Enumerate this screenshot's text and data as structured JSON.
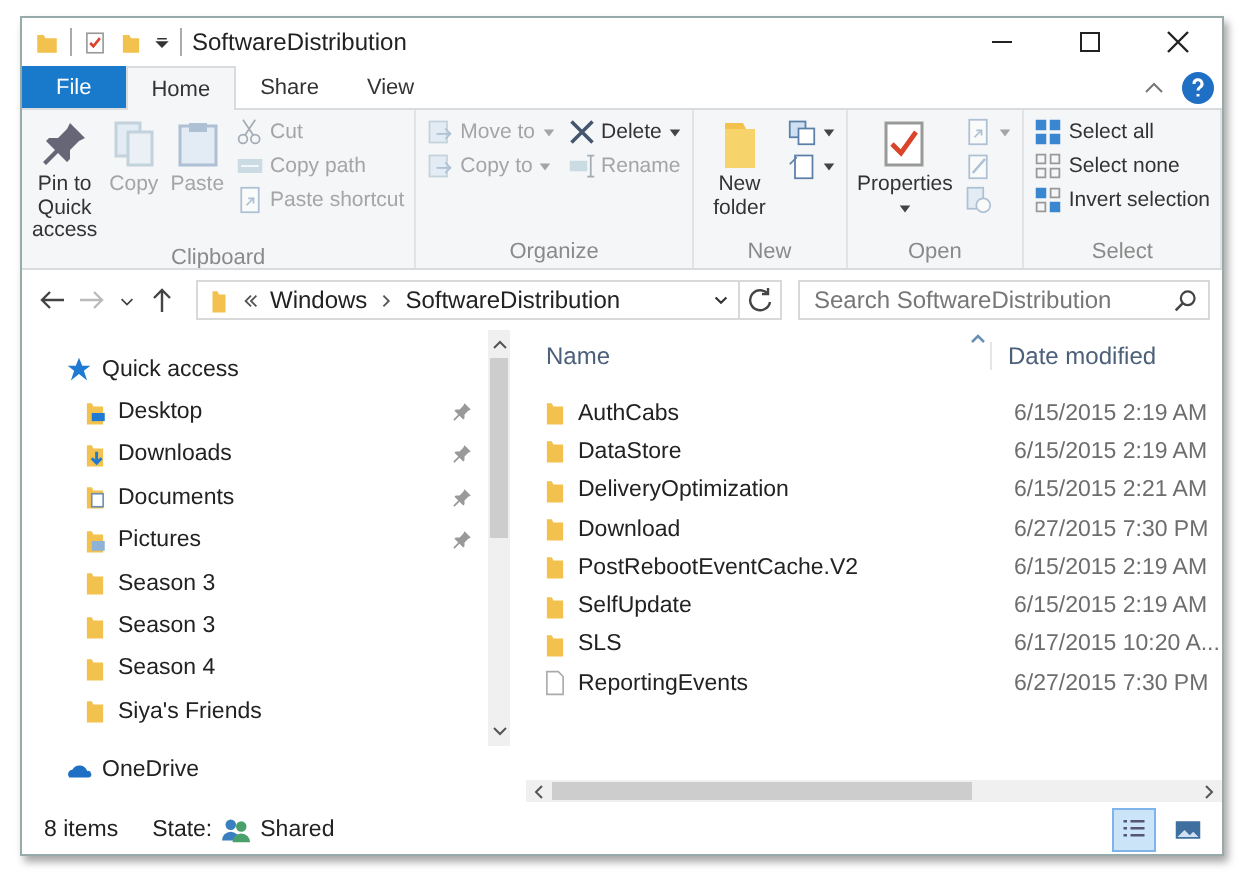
{
  "window": {
    "title": "SoftwareDistribution"
  },
  "ribbon_tabs": [
    {
      "label": "File",
      "kind": "file",
      "selected": false
    },
    {
      "label": "Home",
      "kind": "tab",
      "selected": true
    },
    {
      "label": "Share",
      "kind": "tab",
      "selected": false
    },
    {
      "label": "View",
      "kind": "tab",
      "selected": false
    }
  ],
  "ribbon_groups": [
    {
      "label": "Clipboard",
      "columns": [
        [
          {
            "label": "Pin to Quick access",
            "kind": "large",
            "disabled": false,
            "dropdown": false
          }
        ],
        [
          {
            "label": "Copy",
            "kind": "large",
            "disabled": true,
            "dropdown": false
          }
        ],
        [
          {
            "label": "Paste",
            "kind": "large",
            "disabled": true,
            "dropdown": false
          }
        ],
        [
          {
            "label": "Cut",
            "kind": "small",
            "disabled": true,
            "dropdown": false
          },
          {
            "label": "Copy path",
            "kind": "small",
            "disabled": true,
            "dropdown": false
          },
          {
            "label": "Paste shortcut",
            "kind": "small",
            "disabled": true,
            "dropdown": false
          }
        ]
      ]
    },
    {
      "label": "Organize",
      "columns": [
        [
          {
            "label": "Move to",
            "kind": "small",
            "disabled": true,
            "dropdown": true
          },
          {
            "label": "Copy to",
            "kind": "small",
            "disabled": true,
            "dropdown": true
          }
        ],
        [
          {
            "label": "Delete",
            "kind": "small",
            "disabled": false,
            "dropdown": true
          },
          {
            "label": "Rename",
            "kind": "small",
            "disabled": true,
            "dropdown": false
          }
        ]
      ]
    },
    {
      "label": "New",
      "columns": [
        [
          {
            "label": "New folder",
            "kind": "large",
            "disabled": false,
            "dropdown": false
          }
        ],
        [
          {
            "kind": "icon",
            "disabled": false,
            "dropdown": true
          },
          {
            "kind": "icon",
            "disabled": false,
            "dropdown": true
          }
        ]
      ]
    },
    {
      "label": "Open",
      "columns": [
        [
          {
            "label": "Properties",
            "kind": "large",
            "disabled": false,
            "dropdown": true
          }
        ],
        [
          {
            "kind": "icon",
            "disabled": true,
            "dropdown": true
          },
          {
            "kind": "icon",
            "disabled": true,
            "dropdown": false
          },
          {
            "kind": "icon",
            "disabled": true,
            "dropdown": false
          }
        ]
      ]
    },
    {
      "label": "Select",
      "columns": [
        [
          {
            "label": "Select all",
            "kind": "small",
            "disabled": false,
            "dropdown": false
          },
          {
            "label": "Select none",
            "kind": "small",
            "disabled": false,
            "dropdown": false
          },
          {
            "label": "Invert selection",
            "kind": "small",
            "disabled": false,
            "dropdown": false
          }
        ]
      ]
    }
  ],
  "address": {
    "segments": [
      "Windows",
      "SoftwareDistribution"
    ]
  },
  "search": {
    "placeholder": "Search SoftwareDistribution"
  },
  "nav": [
    {
      "label": "Quick access",
      "kind": "quick-access",
      "children": [
        {
          "label": "Desktop",
          "kind": "desktop",
          "pinned": true
        },
        {
          "label": "Downloads",
          "kind": "downloads",
          "pinned": true
        },
        {
          "label": "Documents",
          "kind": "documents",
          "pinned": true
        },
        {
          "label": "Pictures",
          "kind": "pictures",
          "pinned": true
        },
        {
          "label": "Season 3",
          "kind": "folder",
          "pinned": false
        },
        {
          "label": "Season 3",
          "kind": "folder",
          "pinned": false
        },
        {
          "label": "Season 4",
          "kind": "folder",
          "pinned": false
        },
        {
          "label": "Siya's Friends",
          "kind": "folder",
          "pinned": false
        }
      ]
    },
    {
      "label": "OneDrive",
      "kind": "onedrive"
    }
  ],
  "table": {
    "columns": [
      "Name",
      "Date modified"
    ],
    "rows": [
      {
        "name": "AuthCabs",
        "date": "6/15/2015 2:19 AM",
        "kind": "folder"
      },
      {
        "name": "DataStore",
        "date": "6/15/2015 2:19 AM",
        "kind": "folder"
      },
      {
        "name": "DeliveryOptimization",
        "date": "6/15/2015 2:21 AM",
        "kind": "folder"
      },
      {
        "name": "Download",
        "date": "6/27/2015 7:30 PM",
        "kind": "folder"
      },
      {
        "name": "PostRebootEventCache.V2",
        "date": "6/15/2015 2:19 AM",
        "kind": "folder"
      },
      {
        "name": "SelfUpdate",
        "date": "6/15/2015 2:19 AM",
        "kind": "folder"
      },
      {
        "name": "SLS",
        "date": "6/17/2015 10:20 A...",
        "kind": "folder"
      },
      {
        "name": "ReportingEvents",
        "date": "6/27/2015 7:30 PM",
        "kind": "file"
      }
    ]
  },
  "status_bar": {
    "count": "8 items",
    "state_label": "State:",
    "state": "Shared"
  },
  "view_buttons": [
    {
      "kind": "details",
      "selected": true
    },
    {
      "kind": "large-icons",
      "selected": false
    }
  ]
}
